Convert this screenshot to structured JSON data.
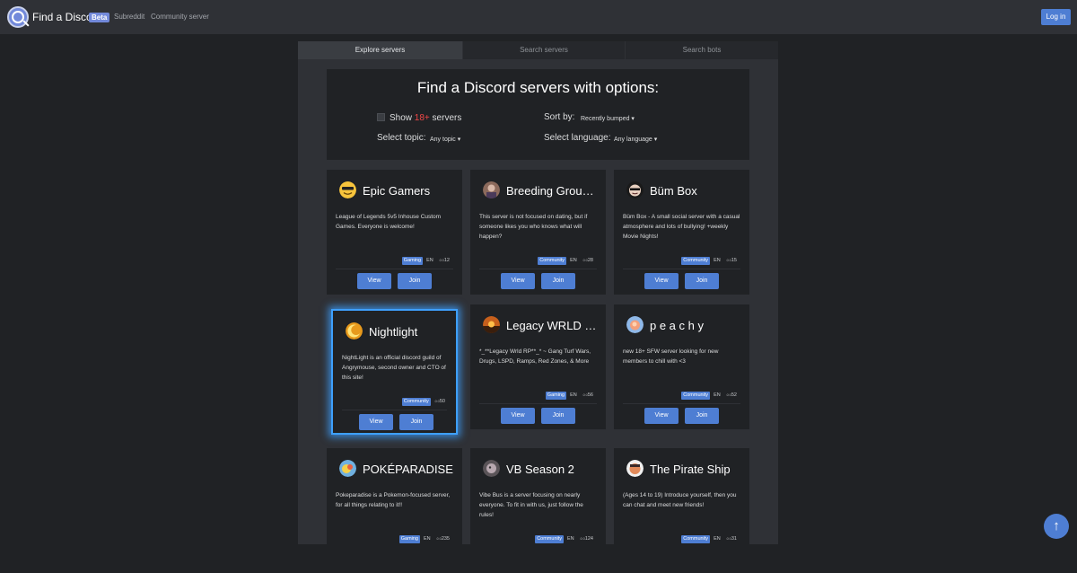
{
  "navbar": {
    "brand": "Find a Discord",
    "badge": "Beta",
    "links": [
      "Subreddit",
      "Community server"
    ],
    "login": "Log in"
  },
  "tabs": [
    "Explore servers",
    "Search servers",
    "Search bots"
  ],
  "options": {
    "title": "Find a Discord servers with options:",
    "show_prefix": "Show",
    "show_age": "18+",
    "show_suffix": "servers",
    "sort_label": "Sort by:",
    "sort_value": "Recently bumped",
    "topic_label": "Select topic:",
    "topic_value": "Any topic",
    "language_label": "Select language:",
    "language_value": "Any language"
  },
  "buttons": {
    "view": "View",
    "join": "Join"
  },
  "servers": [
    {
      "name": "Epic Gamers",
      "desc": "League of Legends 5v5 Inhouse Custom Games. Everyone is welcome!",
      "tag": "Gaming",
      "lang": "EN",
      "users": "12"
    },
    {
      "name": "Breeding Grounds",
      "desc": "This server is not focused on dating, but if someone likes you who knows what will happen?",
      "tag": "Community",
      "lang": "EN",
      "users": "28"
    },
    {
      "name": "Büm Box",
      "desc": "Büm Box - A small social server with a casual atmosphere and lots of bullying! +weekly Movie Nights!",
      "tag": "Community",
      "lang": "EN",
      "users": "15"
    },
    {
      "name": "Nightlight",
      "desc": "NightLight is an official discord guild of Angrymouse, second owner and CTO of this site!",
      "tag": "Community",
      "lang": "EN",
      "users": "50"
    },
    {
      "name": "Legacy WRLD RP",
      "desc": "*_**Legacy Wrld RP**_* ~ Gang Turf Wars, Drugs, LSPD, Ramps, Red Zones, & More",
      "tag": "Gaming",
      "lang": "EN",
      "users": "56"
    },
    {
      "name": "p e a c h y",
      "desc": "new 18+ SFW server looking for new members to chill with <3",
      "tag": "Community",
      "lang": "EN",
      "users": "52"
    },
    {
      "name": "POKÉPARADISE",
      "desc": "Pokeparadise is a Pokemon-focused server, for all things relating to it!!",
      "tag": "Gaming",
      "lang": "EN",
      "users": "235"
    },
    {
      "name": "VB Season 2",
      "desc": "Vibe Bus is a server focusing on nearly everyone. To fit in with us, just follow the rules!",
      "tag": "Community",
      "lang": "EN",
      "users": "124"
    },
    {
      "name": "The Pirate Ship",
      "desc": "(Ages 14 to 19) Introduce yourself, then you can chat and meet new friends!",
      "tag": "Community",
      "lang": "EN",
      "users": "31"
    }
  ],
  "scroll_top": "↑"
}
